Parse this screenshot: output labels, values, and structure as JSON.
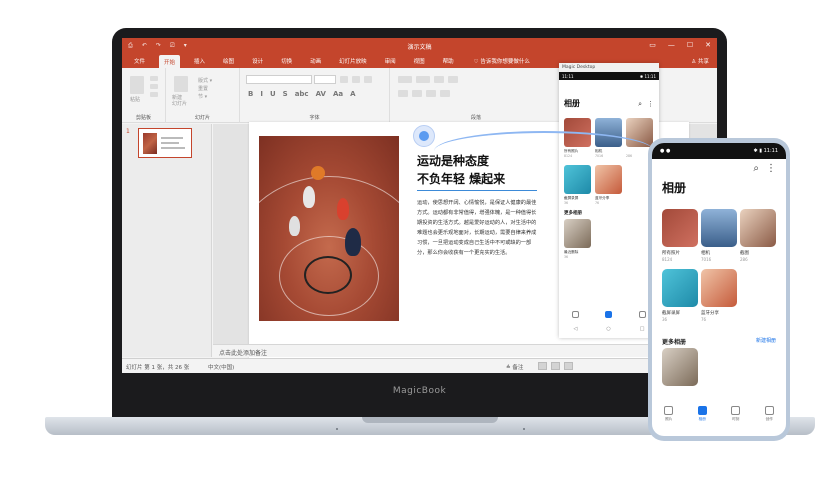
{
  "laptop": {
    "brand": "MagicBook"
  },
  "ppt": {
    "doc_title": "演示文稿",
    "quick_access": [
      "⎙",
      "↶",
      "↷",
      "⎚",
      "▾"
    ],
    "window_controls": [
      "▭",
      "—",
      "☐",
      "✕"
    ],
    "tabs": [
      "文件",
      "开始",
      "插入",
      "绘图",
      "设计",
      "切换",
      "动画",
      "幻灯片放映",
      "审阅",
      "视图",
      "帮助"
    ],
    "active_tab": "开始",
    "tell_me": "♡ 告诉我你想要做什么",
    "share": "♙ 共享",
    "groups": {
      "clipboard": "剪贴板",
      "slides": "幻灯片",
      "font": "字体",
      "paragraph": "段落"
    },
    "ribbon_small": {
      "paste": "粘贴",
      "new_slide": "新建\n幻灯片",
      "layout": "版式 ▾",
      "reset": "重置",
      "section": "节 ▾"
    },
    "format_buttons": [
      "B",
      "I",
      "U",
      "S",
      "abc",
      "AV",
      "Aa",
      "A"
    ],
    "thumbnail_number": "1",
    "slide": {
      "title_line1": "运动是种态度",
      "title_line2": "不负年轻  燥起来",
      "body": "运动，使思想开阔、心情愉悦，是保证人健康的最佳方式。运动都有非常值得，增强体魄，是一种值得长期投资的生活方式。越是爱好运动的人，对生活中的难题也会更乐观地面对，长期运动，需要自律来养成习惯，一旦把运动变成自己生活中不可或缺的一部分，那么你会收获有一个更充实的生活。"
    },
    "notes_placeholder": "点击此处添加备注",
    "status": {
      "slide_count": "幻灯片 第 1 张，共 26 张",
      "language": "中文(中国)",
      "notes": "≙ 备注"
    }
  },
  "magic_desktop": {
    "title": "Magic Desktop",
    "status_left": "11:11",
    "status_right": "✱ 11:11",
    "heading": "相册",
    "icons": [
      "⌕",
      "⋮"
    ],
    "albums": [
      {
        "name": "所有照片",
        "count": "8124"
      },
      {
        "name": "相机",
        "count": "7016"
      },
      {
        "name": "",
        "count": "286"
      },
      {
        "name": "截屏录屏",
        "count": "36"
      },
      {
        "name": "蓝牙分享",
        "count": "76"
      }
    ],
    "more_albums": "更多相册",
    "extra_album": {
      "name": "最近删除",
      "count": "36"
    },
    "sys_nav": [
      "◁",
      "○",
      "□"
    ]
  },
  "phone": {
    "status_left": "● ●",
    "status_right": "✱ ▮ 11:11",
    "heading": "相册",
    "icons": [
      "⌕",
      "⋮"
    ],
    "albums": [
      {
        "name": "所有照片",
        "count": "8124"
      },
      {
        "name": "相机",
        "count": "7016"
      },
      {
        "name": "截图",
        "count": "286"
      },
      {
        "name": "截屏录屏",
        "count": "36"
      },
      {
        "name": "蓝牙分享",
        "count": "76"
      }
    ],
    "more_albums": "更多相册",
    "more_link": "新建相册",
    "nav": [
      "照片",
      "相册",
      "时刻",
      "创作"
    ]
  },
  "colors": {
    "ppt_red": "#c4452c",
    "link_blue": "#3c8ad8",
    "connector": "#5b9bf0"
  }
}
